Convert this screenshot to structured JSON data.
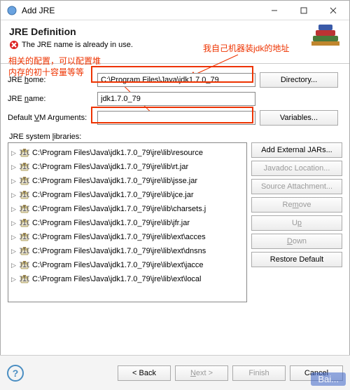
{
  "window": {
    "title": "Add JRE"
  },
  "banner": {
    "heading": "JRE Definition",
    "error": "The JRE name is already in use."
  },
  "annotations": {
    "top_right": "我自己机器装jdk的地址",
    "left_line1": "相关的配置，可以配置堆",
    "left_line2": "内存的初十容量等等"
  },
  "form": {
    "home_label": "JRE home:",
    "home_value": "C:\\Program Files\\Java\\jdk1.7.0_79",
    "directory_btn": "Directory...",
    "name_label": "JRE name:",
    "name_value": "jdk1.7.0_79",
    "args_label": "Default VM Arguments:",
    "args_value": "",
    "variables_btn": "Variables...",
    "libs_label": "JRE system libraries:"
  },
  "jars": [
    "C:\\Program Files\\Java\\jdk1.7.0_79\\jre\\lib\\resource",
    "C:\\Program Files\\Java\\jdk1.7.0_79\\jre\\lib\\rt.jar",
    "C:\\Program Files\\Java\\jdk1.7.0_79\\jre\\lib\\jsse.jar",
    "C:\\Program Files\\Java\\jdk1.7.0_79\\jre\\lib\\jce.jar",
    "C:\\Program Files\\Java\\jdk1.7.0_79\\jre\\lib\\charsets.j",
    "C:\\Program Files\\Java\\jdk1.7.0_79\\jre\\lib\\jfr.jar",
    "C:\\Program Files\\Java\\jdk1.7.0_79\\jre\\lib\\ext\\acces",
    "C:\\Program Files\\Java\\jdk1.7.0_79\\jre\\lib\\ext\\dnsns",
    "C:\\Program Files\\Java\\jdk1.7.0_79\\jre\\lib\\ext\\jacce",
    "C:\\Program Files\\Java\\jdk1.7.0_79\\jre\\lib\\ext\\local"
  ],
  "side_buttons": {
    "add_external": "Add External JARs...",
    "javadoc": "Javadoc Location...",
    "source": "Source Attachment...",
    "remove": "Remove",
    "up": "Up",
    "down": "Down",
    "restore": "Restore Default"
  },
  "footer": {
    "back": "< Back",
    "next": "Next >",
    "finish": "Finish",
    "cancel": "Cancel"
  },
  "watermark": "Bai..."
}
